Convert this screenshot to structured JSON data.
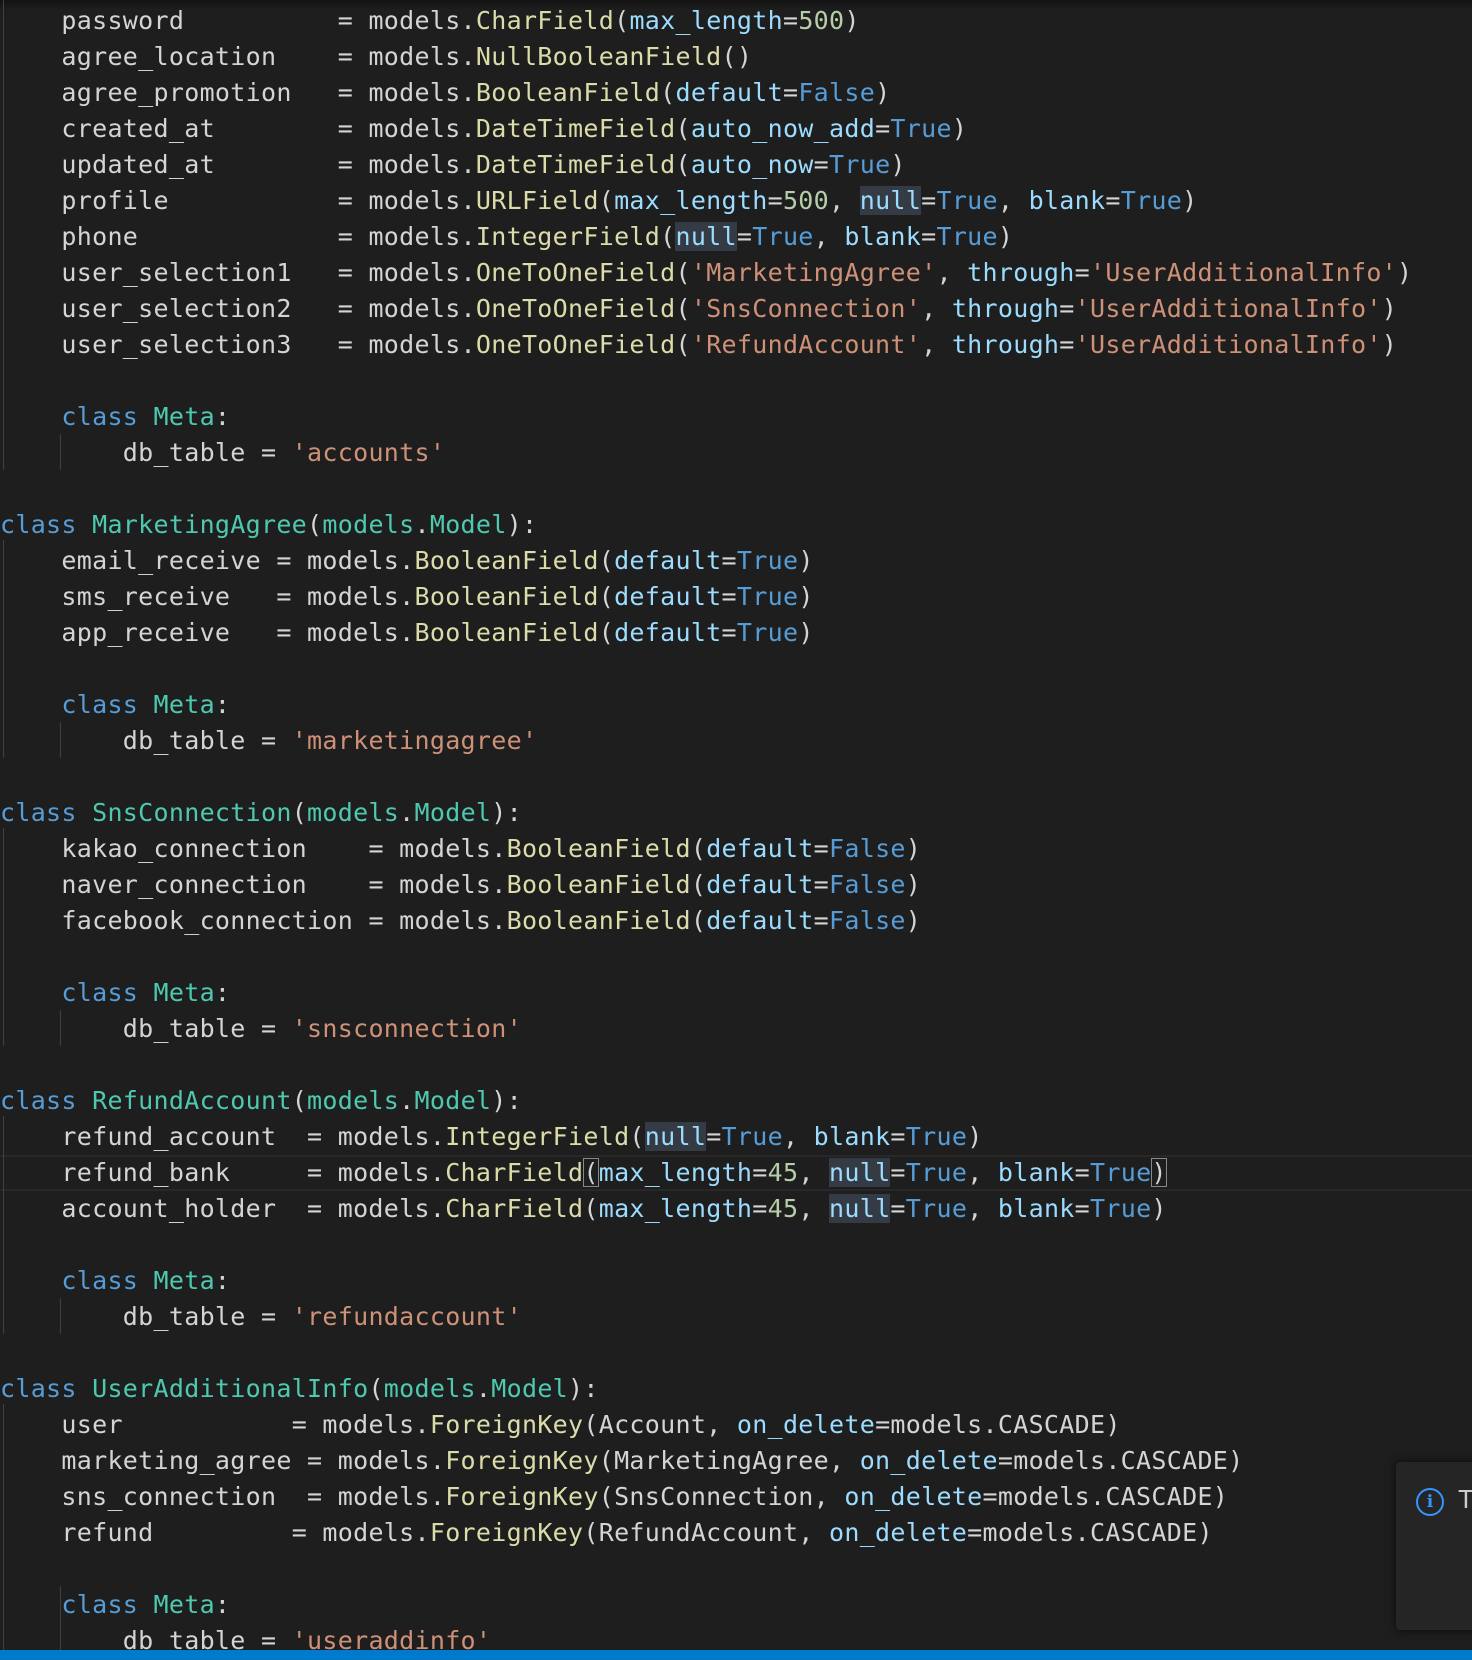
{
  "editor": {
    "language": "python",
    "current_line": 32,
    "lines": [
      [
        [
          "t",
          "    password          "
        ],
        [
          "o",
          "= "
        ],
        [
          "t",
          "models."
        ],
        [
          "f",
          "CharField"
        ],
        [
          "o",
          "("
        ],
        [
          "p",
          "max_length"
        ],
        [
          "o",
          "="
        ],
        [
          "n",
          "500"
        ],
        [
          "o",
          ")"
        ]
      ],
      [
        [
          "t",
          "    agree_location    "
        ],
        [
          "o",
          "= "
        ],
        [
          "t",
          "models."
        ],
        [
          "f",
          "NullBooleanField"
        ],
        [
          "o",
          "()"
        ]
      ],
      [
        [
          "t",
          "    agree_promotion   "
        ],
        [
          "o",
          "= "
        ],
        [
          "t",
          "models."
        ],
        [
          "f",
          "BooleanField"
        ],
        [
          "o",
          "("
        ],
        [
          "p",
          "default"
        ],
        [
          "o",
          "="
        ],
        [
          "k",
          "False"
        ],
        [
          "o",
          ")"
        ]
      ],
      [
        [
          "t",
          "    created_at        "
        ],
        [
          "o",
          "= "
        ],
        [
          "t",
          "models."
        ],
        [
          "f",
          "DateTimeField"
        ],
        [
          "o",
          "("
        ],
        [
          "p",
          "auto_now_add"
        ],
        [
          "o",
          "="
        ],
        [
          "k",
          "True"
        ],
        [
          "o",
          ")"
        ]
      ],
      [
        [
          "t",
          "    updated_at        "
        ],
        [
          "o",
          "= "
        ],
        [
          "t",
          "models."
        ],
        [
          "f",
          "DateTimeField"
        ],
        [
          "o",
          "("
        ],
        [
          "p",
          "auto_now"
        ],
        [
          "o",
          "="
        ],
        [
          "k",
          "True"
        ],
        [
          "o",
          ")"
        ]
      ],
      [
        [
          "t",
          "    profile           "
        ],
        [
          "o",
          "= "
        ],
        [
          "t",
          "models."
        ],
        [
          "f",
          "URLField"
        ],
        [
          "o",
          "("
        ],
        [
          "p",
          "max_length"
        ],
        [
          "o",
          "="
        ],
        [
          "n",
          "500"
        ],
        [
          "o",
          ", "
        ],
        [
          "p",
          "null",
          "hl"
        ],
        [
          "o",
          "="
        ],
        [
          "k",
          "True"
        ],
        [
          "o",
          ", "
        ],
        [
          "p",
          "blank"
        ],
        [
          "o",
          "="
        ],
        [
          "k",
          "True"
        ],
        [
          "o",
          ")"
        ]
      ],
      [
        [
          "t",
          "    phone             "
        ],
        [
          "o",
          "= "
        ],
        [
          "t",
          "models."
        ],
        [
          "f",
          "IntegerField"
        ],
        [
          "o",
          "("
        ],
        [
          "p",
          "null",
          "hl"
        ],
        [
          "o",
          "="
        ],
        [
          "k",
          "True"
        ],
        [
          "o",
          ", "
        ],
        [
          "p",
          "blank"
        ],
        [
          "o",
          "="
        ],
        [
          "k",
          "True"
        ],
        [
          "o",
          ")"
        ]
      ],
      [
        [
          "t",
          "    user_selection1   "
        ],
        [
          "o",
          "= "
        ],
        [
          "t",
          "models."
        ],
        [
          "f",
          "OneToOneField"
        ],
        [
          "o",
          "("
        ],
        [
          "s",
          "'MarketingAgree'"
        ],
        [
          "o",
          ", "
        ],
        [
          "p",
          "through"
        ],
        [
          "o",
          "="
        ],
        [
          "s",
          "'UserAdditionalInfo'"
        ],
        [
          "o",
          ")"
        ]
      ],
      [
        [
          "t",
          "    user_selection2   "
        ],
        [
          "o",
          "= "
        ],
        [
          "t",
          "models."
        ],
        [
          "f",
          "OneToOneField"
        ],
        [
          "o",
          "("
        ],
        [
          "s",
          "'SnsConnection'"
        ],
        [
          "o",
          ", "
        ],
        [
          "p",
          "through"
        ],
        [
          "o",
          "="
        ],
        [
          "s",
          "'UserAdditionalInfo'"
        ],
        [
          "o",
          ")"
        ]
      ],
      [
        [
          "t",
          "    user_selection3   "
        ],
        [
          "o",
          "= "
        ],
        [
          "t",
          "models."
        ],
        [
          "f",
          "OneToOneField"
        ],
        [
          "o",
          "("
        ],
        [
          "s",
          "'RefundAccount'"
        ],
        [
          "o",
          ", "
        ],
        [
          "p",
          "through"
        ],
        [
          "o",
          "="
        ],
        [
          "s",
          "'UserAdditionalInfo'"
        ],
        [
          "o",
          ")"
        ]
      ],
      [],
      [
        [
          "t",
          "    "
        ],
        [
          "k",
          "class "
        ],
        [
          "c",
          "Meta"
        ],
        [
          "o",
          ":"
        ]
      ],
      [
        [
          "t",
          "        db_table "
        ],
        [
          "o",
          "= "
        ],
        [
          "s",
          "'accounts'"
        ]
      ],
      [],
      [
        [
          "k",
          "class "
        ],
        [
          "c",
          "MarketingAgree"
        ],
        [
          "o",
          "("
        ],
        [
          "c",
          "models"
        ],
        [
          "o",
          "."
        ],
        [
          "c",
          "Model"
        ],
        [
          "o",
          "):"
        ]
      ],
      [
        [
          "t",
          "    email_receive "
        ],
        [
          "o",
          "= "
        ],
        [
          "t",
          "models."
        ],
        [
          "f",
          "BooleanField"
        ],
        [
          "o",
          "("
        ],
        [
          "p",
          "default"
        ],
        [
          "o",
          "="
        ],
        [
          "k",
          "True"
        ],
        [
          "o",
          ")"
        ]
      ],
      [
        [
          "t",
          "    sms_receive   "
        ],
        [
          "o",
          "= "
        ],
        [
          "t",
          "models."
        ],
        [
          "f",
          "BooleanField"
        ],
        [
          "o",
          "("
        ],
        [
          "p",
          "default"
        ],
        [
          "o",
          "="
        ],
        [
          "k",
          "True"
        ],
        [
          "o",
          ")"
        ]
      ],
      [
        [
          "t",
          "    app_receive   "
        ],
        [
          "o",
          "= "
        ],
        [
          "t",
          "models."
        ],
        [
          "f",
          "BooleanField"
        ],
        [
          "o",
          "("
        ],
        [
          "p",
          "default"
        ],
        [
          "o",
          "="
        ],
        [
          "k",
          "True"
        ],
        [
          "o",
          ")"
        ]
      ],
      [],
      [
        [
          "t",
          "    "
        ],
        [
          "k",
          "class "
        ],
        [
          "c",
          "Meta"
        ],
        [
          "o",
          ":"
        ]
      ],
      [
        [
          "t",
          "        db_table "
        ],
        [
          "o",
          "= "
        ],
        [
          "s",
          "'marketingagree'"
        ]
      ],
      [],
      [
        [
          "k",
          "class "
        ],
        [
          "c",
          "SnsConnection"
        ],
        [
          "o",
          "("
        ],
        [
          "c",
          "models"
        ],
        [
          "o",
          "."
        ],
        [
          "c",
          "Model"
        ],
        [
          "o",
          "):"
        ]
      ],
      [
        [
          "t",
          "    kakao_connection    "
        ],
        [
          "o",
          "= "
        ],
        [
          "t",
          "models."
        ],
        [
          "f",
          "BooleanField"
        ],
        [
          "o",
          "("
        ],
        [
          "p",
          "default"
        ],
        [
          "o",
          "="
        ],
        [
          "k",
          "False"
        ],
        [
          "o",
          ")"
        ]
      ],
      [
        [
          "t",
          "    naver_connection    "
        ],
        [
          "o",
          "= "
        ],
        [
          "t",
          "models."
        ],
        [
          "f",
          "BooleanField"
        ],
        [
          "o",
          "("
        ],
        [
          "p",
          "default"
        ],
        [
          "o",
          "="
        ],
        [
          "k",
          "False"
        ],
        [
          "o",
          ")"
        ]
      ],
      [
        [
          "t",
          "    facebook_connection "
        ],
        [
          "o",
          "= "
        ],
        [
          "t",
          "models."
        ],
        [
          "f",
          "BooleanField"
        ],
        [
          "o",
          "("
        ],
        [
          "p",
          "default"
        ],
        [
          "o",
          "="
        ],
        [
          "k",
          "False"
        ],
        [
          "o",
          ")"
        ]
      ],
      [],
      [
        [
          "t",
          "    "
        ],
        [
          "k",
          "class "
        ],
        [
          "c",
          "Meta"
        ],
        [
          "o",
          ":"
        ]
      ],
      [
        [
          "t",
          "        db_table "
        ],
        [
          "o",
          "= "
        ],
        [
          "s",
          "'snsconnection'"
        ]
      ],
      [],
      [
        [
          "k",
          "class "
        ],
        [
          "c",
          "RefundAccount"
        ],
        [
          "o",
          "("
        ],
        [
          "c",
          "models"
        ],
        [
          "o",
          "."
        ],
        [
          "c",
          "Model"
        ],
        [
          "o",
          "):"
        ]
      ],
      [
        [
          "t",
          "    refund_account  "
        ],
        [
          "o",
          "= "
        ],
        [
          "t",
          "models."
        ],
        [
          "f",
          "IntegerField"
        ],
        [
          "o",
          "("
        ],
        [
          "p",
          "null",
          "hl"
        ],
        [
          "o",
          "="
        ],
        [
          "k",
          "True"
        ],
        [
          "o",
          ", "
        ],
        [
          "p",
          "blank"
        ],
        [
          "o",
          "="
        ],
        [
          "k",
          "True"
        ],
        [
          "o",
          ")"
        ]
      ],
      [
        [
          "t",
          "    refund_bank     "
        ],
        [
          "o",
          "= "
        ],
        [
          "t",
          "models."
        ],
        [
          "f",
          "CharField"
        ],
        [
          "o",
          "(",
          "bm"
        ],
        [
          "p",
          "max_length"
        ],
        [
          "o",
          "="
        ],
        [
          "n",
          "45"
        ],
        [
          "o",
          ", "
        ],
        [
          "p",
          "null",
          "hl"
        ],
        [
          "o",
          "="
        ],
        [
          "k",
          "True"
        ],
        [
          "o",
          ", "
        ],
        [
          "p",
          "blank"
        ],
        [
          "o",
          "="
        ],
        [
          "k",
          "True"
        ],
        [
          "o",
          ")",
          "bm"
        ]
      ],
      [
        [
          "t",
          "    account_holder  "
        ],
        [
          "o",
          "= "
        ],
        [
          "t",
          "models."
        ],
        [
          "f",
          "CharField"
        ],
        [
          "o",
          "("
        ],
        [
          "p",
          "max_length"
        ],
        [
          "o",
          "="
        ],
        [
          "n",
          "45"
        ],
        [
          "o",
          ", "
        ],
        [
          "p",
          "null",
          "hl"
        ],
        [
          "o",
          "="
        ],
        [
          "k",
          "True"
        ],
        [
          "o",
          ", "
        ],
        [
          "p",
          "blank"
        ],
        [
          "o",
          "="
        ],
        [
          "k",
          "True"
        ],
        [
          "o",
          ")"
        ]
      ],
      [],
      [
        [
          "t",
          "    "
        ],
        [
          "k",
          "class "
        ],
        [
          "c",
          "Meta"
        ],
        [
          "o",
          ":"
        ]
      ],
      [
        [
          "t",
          "        db_table "
        ],
        [
          "o",
          "= "
        ],
        [
          "s",
          "'refundaccount'"
        ]
      ],
      [],
      [
        [
          "k",
          "class "
        ],
        [
          "c",
          "UserAdditionalInfo"
        ],
        [
          "o",
          "("
        ],
        [
          "c",
          "models"
        ],
        [
          "o",
          "."
        ],
        [
          "c",
          "Model"
        ],
        [
          "o",
          "):"
        ]
      ],
      [
        [
          "t",
          "    user           "
        ],
        [
          "o",
          "= "
        ],
        [
          "t",
          "models."
        ],
        [
          "f",
          "ForeignKey"
        ],
        [
          "o",
          "(Account, "
        ],
        [
          "p",
          "on_delete"
        ],
        [
          "o",
          "=models.CASCADE)"
        ]
      ],
      [
        [
          "t",
          "    marketing_agree "
        ],
        [
          "o",
          "= "
        ],
        [
          "t",
          "models."
        ],
        [
          "f",
          "ForeignKey"
        ],
        [
          "o",
          "(MarketingAgree, "
        ],
        [
          "p",
          "on_delete"
        ],
        [
          "o",
          "=models.CASCADE)"
        ]
      ],
      [
        [
          "t",
          "    sns_connection  "
        ],
        [
          "o",
          "= "
        ],
        [
          "t",
          "models."
        ],
        [
          "f",
          "ForeignKey"
        ],
        [
          "o",
          "(SnsConnection, "
        ],
        [
          "p",
          "on_delete"
        ],
        [
          "o",
          "=models.CASCADE)"
        ]
      ],
      [
        [
          "t",
          "    refund         "
        ],
        [
          "o",
          "= "
        ],
        [
          "t",
          "models."
        ],
        [
          "f",
          "ForeignKey"
        ],
        [
          "o",
          "(RefundAccount, "
        ],
        [
          "p",
          "on_delete"
        ],
        [
          "o",
          "=models.CASCADE)"
        ]
      ],
      [],
      [
        [
          "t",
          "    "
        ],
        [
          "k",
          "class "
        ],
        [
          "c",
          "Meta"
        ],
        [
          "o",
          ":"
        ]
      ],
      [
        [
          "t",
          "        db_table "
        ],
        [
          "o",
          "= "
        ],
        [
          "s",
          "'useraddinfo'"
        ]
      ]
    ]
  },
  "notification": {
    "icon": "info-icon",
    "text": "T"
  },
  "colors": {
    "background": "#1e1e1e",
    "keyword": "#569cd6",
    "class_name": "#4ec9b0",
    "function": "#dcdcaa",
    "parameter": "#9cdcfe",
    "string": "#ce9178",
    "number": "#b5cea8",
    "status_bar": "#007acc"
  }
}
